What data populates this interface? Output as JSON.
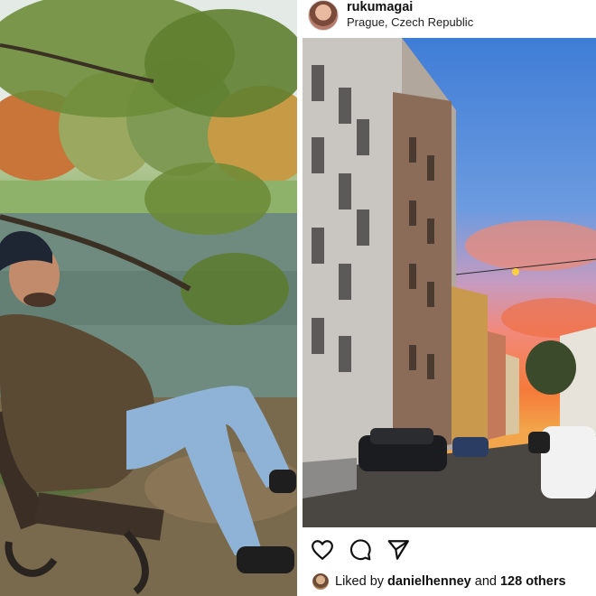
{
  "left_photo": {
    "alt_subject": ""
  },
  "post": {
    "username": "rukumagai",
    "location": "Prague, Czech Republic",
    "actions": {
      "like_icon": "heart-icon",
      "comment_icon": "comment-icon",
      "share_icon": "send-icon"
    },
    "likes": {
      "prefix": "Liked by",
      "liker": "danielhenney",
      "conjunction": "and",
      "others": "128 others"
    }
  },
  "colors": {
    "sky_top": "#4f86d6",
    "sunset": "#f5803f",
    "text": "#111111"
  }
}
